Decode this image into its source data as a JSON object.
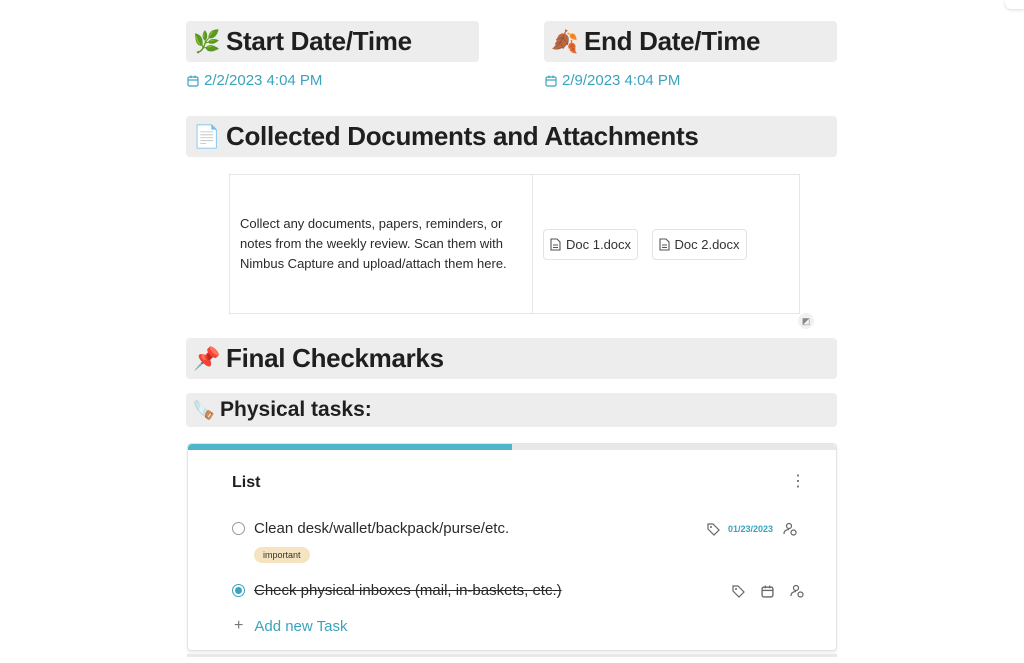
{
  "start": {
    "emoji": "🌿",
    "title": "Start Date/Time",
    "date": "2/2/2023 4:04 PM"
  },
  "end": {
    "emoji": "🍂",
    "title": "End Date/Time",
    "date": "2/9/2023 4:04 PM"
  },
  "docs_section": {
    "emoji": "📄",
    "title": "Collected Documents and Attachments",
    "description": "Collect any documents, papers, reminders, or notes from the weekly review. Scan them with Nimbus Capture and upload/attach them here.",
    "files": [
      "Doc 1.docx",
      "Doc 2.docx"
    ]
  },
  "final": {
    "emoji": "📌",
    "title": "Final Checkmarks"
  },
  "physical": {
    "emoji": "🪚",
    "title": "Physical tasks:"
  },
  "task_list": {
    "title": "List",
    "progress": 0.5,
    "tasks": [
      {
        "label": "Clean desk/wallet/backpack/purse/etc.",
        "completed": false,
        "tag": "important",
        "due": "01/23/2023"
      },
      {
        "label": "Check physical inboxes (mail, in-baskets, etc.)",
        "completed": true
      }
    ],
    "add_label": "Add new Task"
  },
  "colors": {
    "accent": "#3aa3bd",
    "heading_bg": "#ededed",
    "tag_bg": "#f6e3c0"
  }
}
